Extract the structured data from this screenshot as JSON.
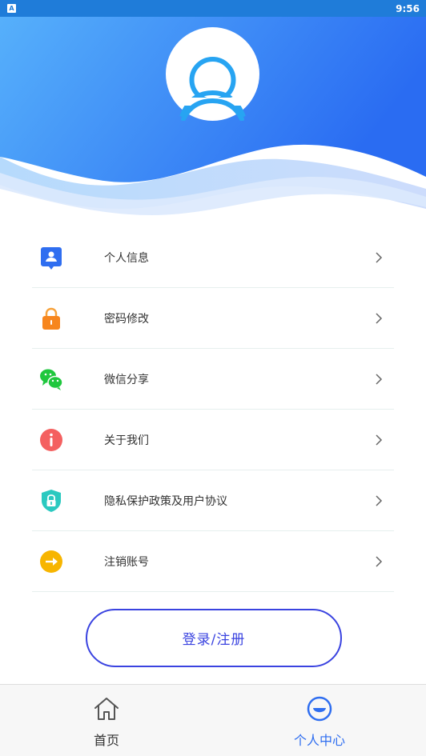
{
  "status_bar": {
    "app_icon_letter": "A",
    "time": "9:56"
  },
  "header": {
    "avatar_icon": "user-icon",
    "gradient_colors": [
      "#55aaf8",
      "#2f6ef0"
    ]
  },
  "menu": {
    "items": [
      {
        "label": "个人信息",
        "icon": "id-card-icon",
        "color": "#2f6ef0"
      },
      {
        "label": "密码修改",
        "icon": "lock-icon",
        "color": "#f7861e"
      },
      {
        "label": "微信分享",
        "icon": "wechat-icon",
        "color": "#1fc73d"
      },
      {
        "label": "关于我们",
        "icon": "info-icon",
        "color": "#f46060"
      },
      {
        "label": "隐私保护政策及用户协议",
        "icon": "shield-icon",
        "color": "#2bc9c0"
      },
      {
        "label": "注销账号",
        "icon": "logout-icon",
        "color": "#f7b500"
      }
    ]
  },
  "login_button": {
    "label": "登录/注册",
    "color": "#3a43e0"
  },
  "tabbar": {
    "tabs": [
      {
        "label": "首页",
        "icon": "home-icon",
        "active": false
      },
      {
        "label": "个人中心",
        "icon": "smile-icon",
        "active": true
      }
    ]
  }
}
